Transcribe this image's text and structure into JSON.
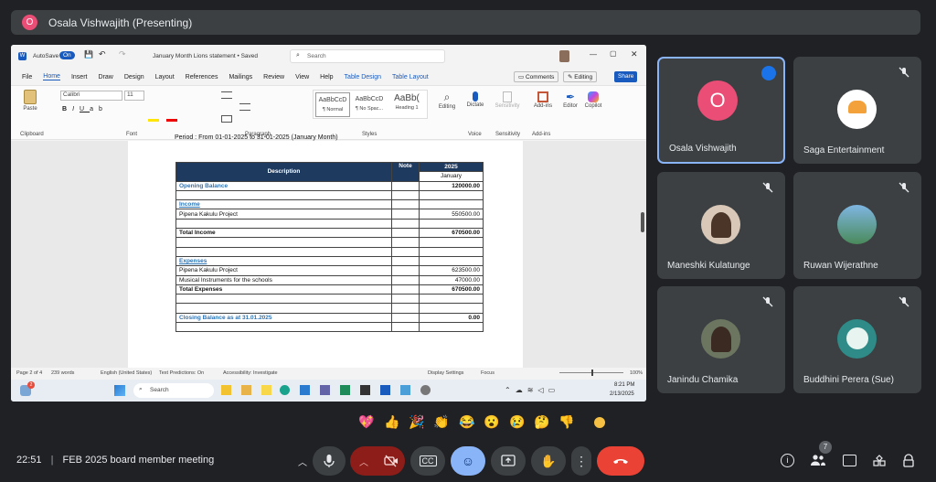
{
  "presenter": {
    "initial": "O",
    "title": "Osala Vishwajith (Presenting)"
  },
  "word": {
    "autosave": "AutoSave",
    "autosave_state": "On",
    "doc_title": "January Month Lions statement • Saved",
    "search_placeholder": "Search",
    "menu": [
      "File",
      "Home",
      "Insert",
      "Draw",
      "Design",
      "Layout",
      "References",
      "Mailings",
      "Review",
      "View",
      "Help",
      "Table Design",
      "Table Layout"
    ],
    "comments": "Comments",
    "editing": "Editing",
    "share": "Share",
    "font_name": "Calibri",
    "font_size": "11",
    "styles": [
      {
        "preview": "AaBbCcD",
        "name": "¶ Normal"
      },
      {
        "preview": "AaBbCcD",
        "name": "¶ No Spac..."
      },
      {
        "preview": "AaBb(",
        "name": "Heading 1"
      }
    ],
    "groups": [
      "Clipboard",
      "Font",
      "Paragraph",
      "Styles",
      "Voice",
      "Sensitivity",
      "Add-ins"
    ],
    "ribbon_buttons": [
      "Paste",
      "Editing",
      "Dictate",
      "Sensitivity",
      "Add-ins",
      "Editor",
      "Copilot"
    ],
    "period": "Period : From 01-01-2025 to 31-01-2025 (January Month)",
    "table": {
      "header_desc": "Description",
      "header_note": "Note",
      "header_year": "2025",
      "header_month": "January",
      "rows": [
        {
          "desc": "Opening Balance",
          "val": "120000.00",
          "style": "blue",
          "valstyle": "bold"
        },
        {
          "desc": "",
          "val": ""
        },
        {
          "desc": "Income",
          "val": "",
          "style": "blue-ul"
        },
        {
          "desc": "Pipena Kakulu Project",
          "val": "550500.00"
        },
        {
          "desc": "",
          "val": ""
        },
        {
          "desc": "Total Income",
          "val": "670500.00",
          "style": "bold"
        },
        {
          "desc": "",
          "val": ""
        },
        {
          "desc": "",
          "val": ""
        },
        {
          "desc": "Expenses",
          "val": "",
          "style": "blue-ul"
        },
        {
          "desc": "Pipena Kakulu Project",
          "val": "623500.00"
        },
        {
          "desc": "Musical Instruments for the schools",
          "val": "47000.00"
        },
        {
          "desc": "Total Expenses",
          "val": "670500.00",
          "style": "bold",
          "valstyle": "bold"
        },
        {
          "desc": "",
          "val": ""
        },
        {
          "desc": "",
          "val": ""
        },
        {
          "desc": "Closing Balance as at 31.01.2025",
          "val": "0.00",
          "style": "blue",
          "valstyle": "bold"
        },
        {
          "desc": "",
          "val": ""
        }
      ]
    },
    "status": {
      "page": "Page 2 of 4",
      "words": "239 words",
      "language": "English (United States)",
      "predictions": "Text Predictions: On",
      "accessibility": "Accessibility: Investigate",
      "display": "Display Settings",
      "focus": "Focus",
      "zoom": "100%"
    },
    "taskbar": {
      "search": "Search",
      "time": "8:21 PM",
      "date": "2/13/2025",
      "badge": "2"
    }
  },
  "participants": [
    {
      "name": "Osala Vishwajith",
      "initial": "O",
      "speaking": true
    },
    {
      "name": "Saga Entertainment",
      "muted": true
    },
    {
      "name": "Maneshki Kulatunge",
      "muted": true
    },
    {
      "name": "Ruwan Wijerathne",
      "muted": true
    },
    {
      "name": "Janindu Chamika",
      "muted": true
    },
    {
      "name": "Buddhini Perera (Sue)",
      "muted": true
    }
  ],
  "meeting": {
    "time": "22:51",
    "separator": "|",
    "title": "FEB 2025 board member meeting",
    "people_count": "7"
  },
  "reactions": [
    "💖",
    "👍",
    "🎉",
    "👏",
    "😂",
    "😮",
    "😢",
    "🤔",
    "👎"
  ],
  "colors": {
    "accent": "#8ab4f8",
    "end_call": "#ea4335",
    "presenter_avatar": "#ea4d75",
    "table_header": "#1f3a5f"
  }
}
